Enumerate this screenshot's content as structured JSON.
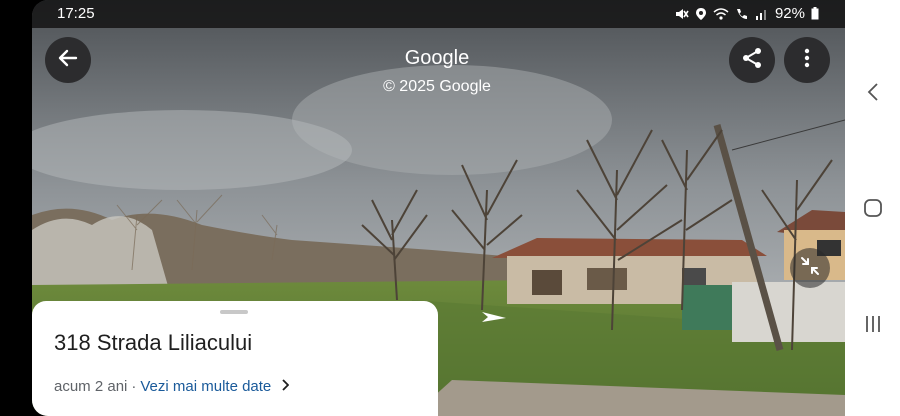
{
  "status": {
    "time": "17:25",
    "battery": "92%",
    "icons": [
      "mute-icon",
      "location-icon",
      "wifi-call-icon",
      "call-icon",
      "signal-icon",
      "battery-icon"
    ]
  },
  "header": {
    "title": "Google",
    "copyright": "© 2025 Google",
    "back_icon": "arrow-left-icon",
    "share_icon": "share-icon",
    "more_icon": "more-vertical-icon"
  },
  "view": {
    "collapse_icon": "collapse-arrows-icon",
    "nav_arrow_icon": "navigation-arrow-icon"
  },
  "card": {
    "address": "318 Strada Liliacului",
    "age": "acum 2 ani",
    "separator": "·",
    "more_link": "Vezi mai multe date",
    "chevron_icon": "chevron-right-icon"
  },
  "android_nav": {
    "back_icon": "nav-back-icon",
    "home_icon": "nav-home-icon",
    "recents_icon": "nav-recents-icon"
  }
}
